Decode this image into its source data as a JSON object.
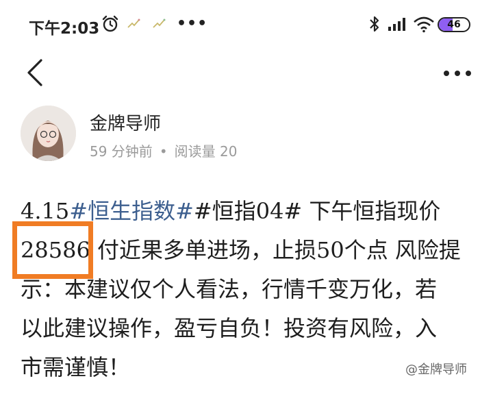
{
  "status_bar": {
    "time": "下午2:03",
    "battery_level": "46",
    "more_label": "•••"
  },
  "author": {
    "name": "金牌导师",
    "time_ago": "59 分钟前",
    "separator": "•",
    "reads": "阅读量 20"
  },
  "article": {
    "lines": [
      [
        "4.15",
        "#恒生指数#",
        "#恒指04#  下午恒指现价"
      ],
      [
        "28586",
        " 付近果多单进场，止损50个点 风险提"
      ],
      [
        "示：本建议仅个人看法，行情千变万化，若"
      ],
      [
        "以此建议操作，盈亏自负！投资有风险，入"
      ],
      [
        "市需谨慎！"
      ]
    ]
  },
  "watermark": "@金牌导师",
  "colors": {
    "tag": "#3d5f8f",
    "highlight": "#f07c24",
    "battery": "#8f5ff2"
  }
}
